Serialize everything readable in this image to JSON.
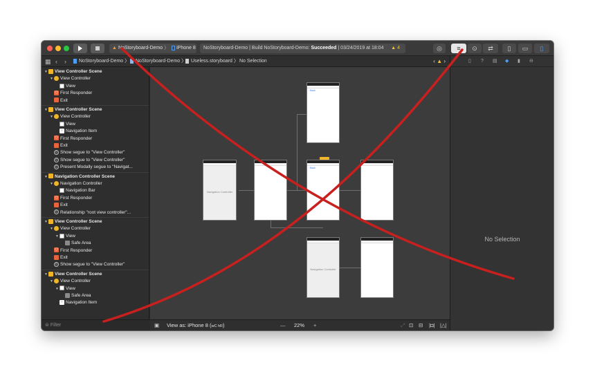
{
  "toolbar": {
    "scheme_name": "NoStoryboard-Demo",
    "device": "iPhone 8",
    "status_prefix": "NoStoryboard-Demo | Build NoStoryboard-Demo: ",
    "status_result": "Succeeded",
    "status_date": " | 03/24/2019 at 18:04",
    "warning_count": "4",
    "run_icon": "play-icon",
    "stop_icon": "stop-icon"
  },
  "jumpbar": {
    "back": "‹",
    "forward": "›",
    "crumb1": "NoStoryboard-Demo",
    "crumb2": "NoStoryboard-Demo",
    "crumb3": "Useless.storyboard",
    "crumb4": "No Selection"
  },
  "navigator": {
    "filter_placeholder": "Filter",
    "rows": [
      {
        "text": "View Controller Scene",
        "kind": "scene"
      },
      {
        "text": "View Controller",
        "kind": "vc"
      },
      {
        "text": "View",
        "kind": "view"
      },
      {
        "text": "First Responder",
        "kind": "fr"
      },
      {
        "text": "Exit",
        "kind": "exit"
      },
      {
        "text": "View Controller Scene",
        "kind": "scene"
      },
      {
        "text": "View Controller",
        "kind": "vc"
      },
      {
        "text": "View",
        "kind": "view"
      },
      {
        "text": "Navigation Item",
        "kind": "navitem"
      },
      {
        "text": "First Responder",
        "kind": "fr"
      },
      {
        "text": "Exit",
        "kind": "exit"
      },
      {
        "text": "Show segue to \"View Controller\"",
        "kind": "segue"
      },
      {
        "text": "Show segue to \"View Controller\"",
        "kind": "segue"
      },
      {
        "text": "Present Modally segue to \"Navigat...",
        "kind": "segue"
      },
      {
        "text": "Navigation Controller Scene",
        "kind": "scene"
      },
      {
        "text": "Navigation Controller",
        "kind": "vc"
      },
      {
        "text": "Navigation Bar",
        "kind": "view"
      },
      {
        "text": "First Responder",
        "kind": "fr"
      },
      {
        "text": "Exit",
        "kind": "exit"
      },
      {
        "text": "Relationship \"root view controller\"...",
        "kind": "segue"
      },
      {
        "text": "View Controller Scene",
        "kind": "scene"
      },
      {
        "text": "View Controller",
        "kind": "vc"
      },
      {
        "text": "View",
        "kind": "view"
      },
      {
        "text": "Safe Area",
        "kind": "safe"
      },
      {
        "text": "First Responder",
        "kind": "fr"
      },
      {
        "text": "Exit",
        "kind": "exit"
      },
      {
        "text": "Show segue to \"View Controller\"",
        "kind": "segue"
      },
      {
        "text": "View Controller Scene",
        "kind": "scene"
      },
      {
        "text": "View Controller",
        "kind": "vc"
      },
      {
        "text": "View",
        "kind": "view"
      },
      {
        "text": "Safe Area",
        "kind": "safe"
      },
      {
        "text": "Navigation Item",
        "kind": "navitem"
      }
    ]
  },
  "canvas": {
    "nav_controller_label": "Navigation Controller",
    "nav_controller_label_2": "Navigation Controller",
    "view_as": "View as: iPhone 8 (",
    "view_as_traits": "wC hR",
    "view_as_close": ")",
    "zoom_minus": "—",
    "zoom": "22%",
    "zoom_plus": "+"
  },
  "inspector": {
    "no_selection": "No Selection",
    "tabs": [
      "file-icon",
      "help-icon",
      "identity-icon",
      "attributes-icon",
      "size-icon",
      "connections-icon"
    ]
  },
  "colors": {
    "accent": "#4d9ef6",
    "warning": "#f5c33b",
    "cross": "#c8201e"
  }
}
